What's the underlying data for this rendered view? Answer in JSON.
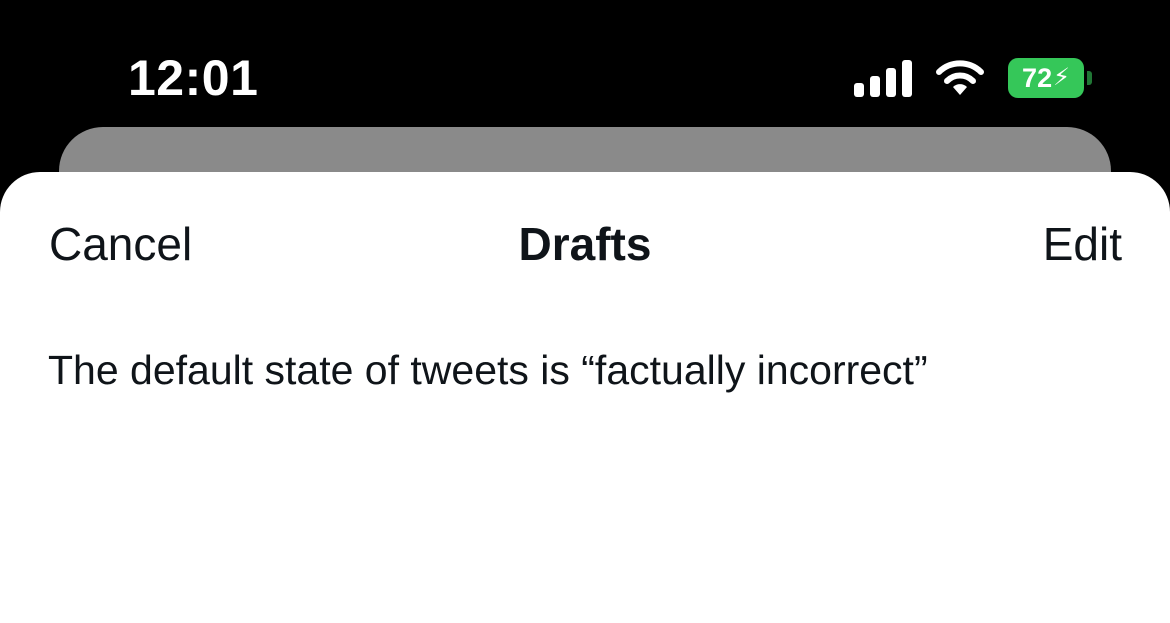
{
  "status_bar": {
    "time": "12:01",
    "battery_level": "72",
    "battery_percent": 72,
    "icons": [
      "signal-icon",
      "wifi-icon",
      "battery-icon",
      "bolt-icon"
    ],
    "battery_color": "#35c759"
  },
  "sheet": {
    "cancel_label": "Cancel",
    "title": "Drafts",
    "edit_label": "Edit",
    "drafts": [
      {
        "text": "The default state of tweets is “factually incorrect”"
      }
    ]
  },
  "colors": {
    "background": "#000000",
    "sheet": "#ffffff",
    "back_card": "#8a8a8a",
    "text": "#0f1419"
  }
}
